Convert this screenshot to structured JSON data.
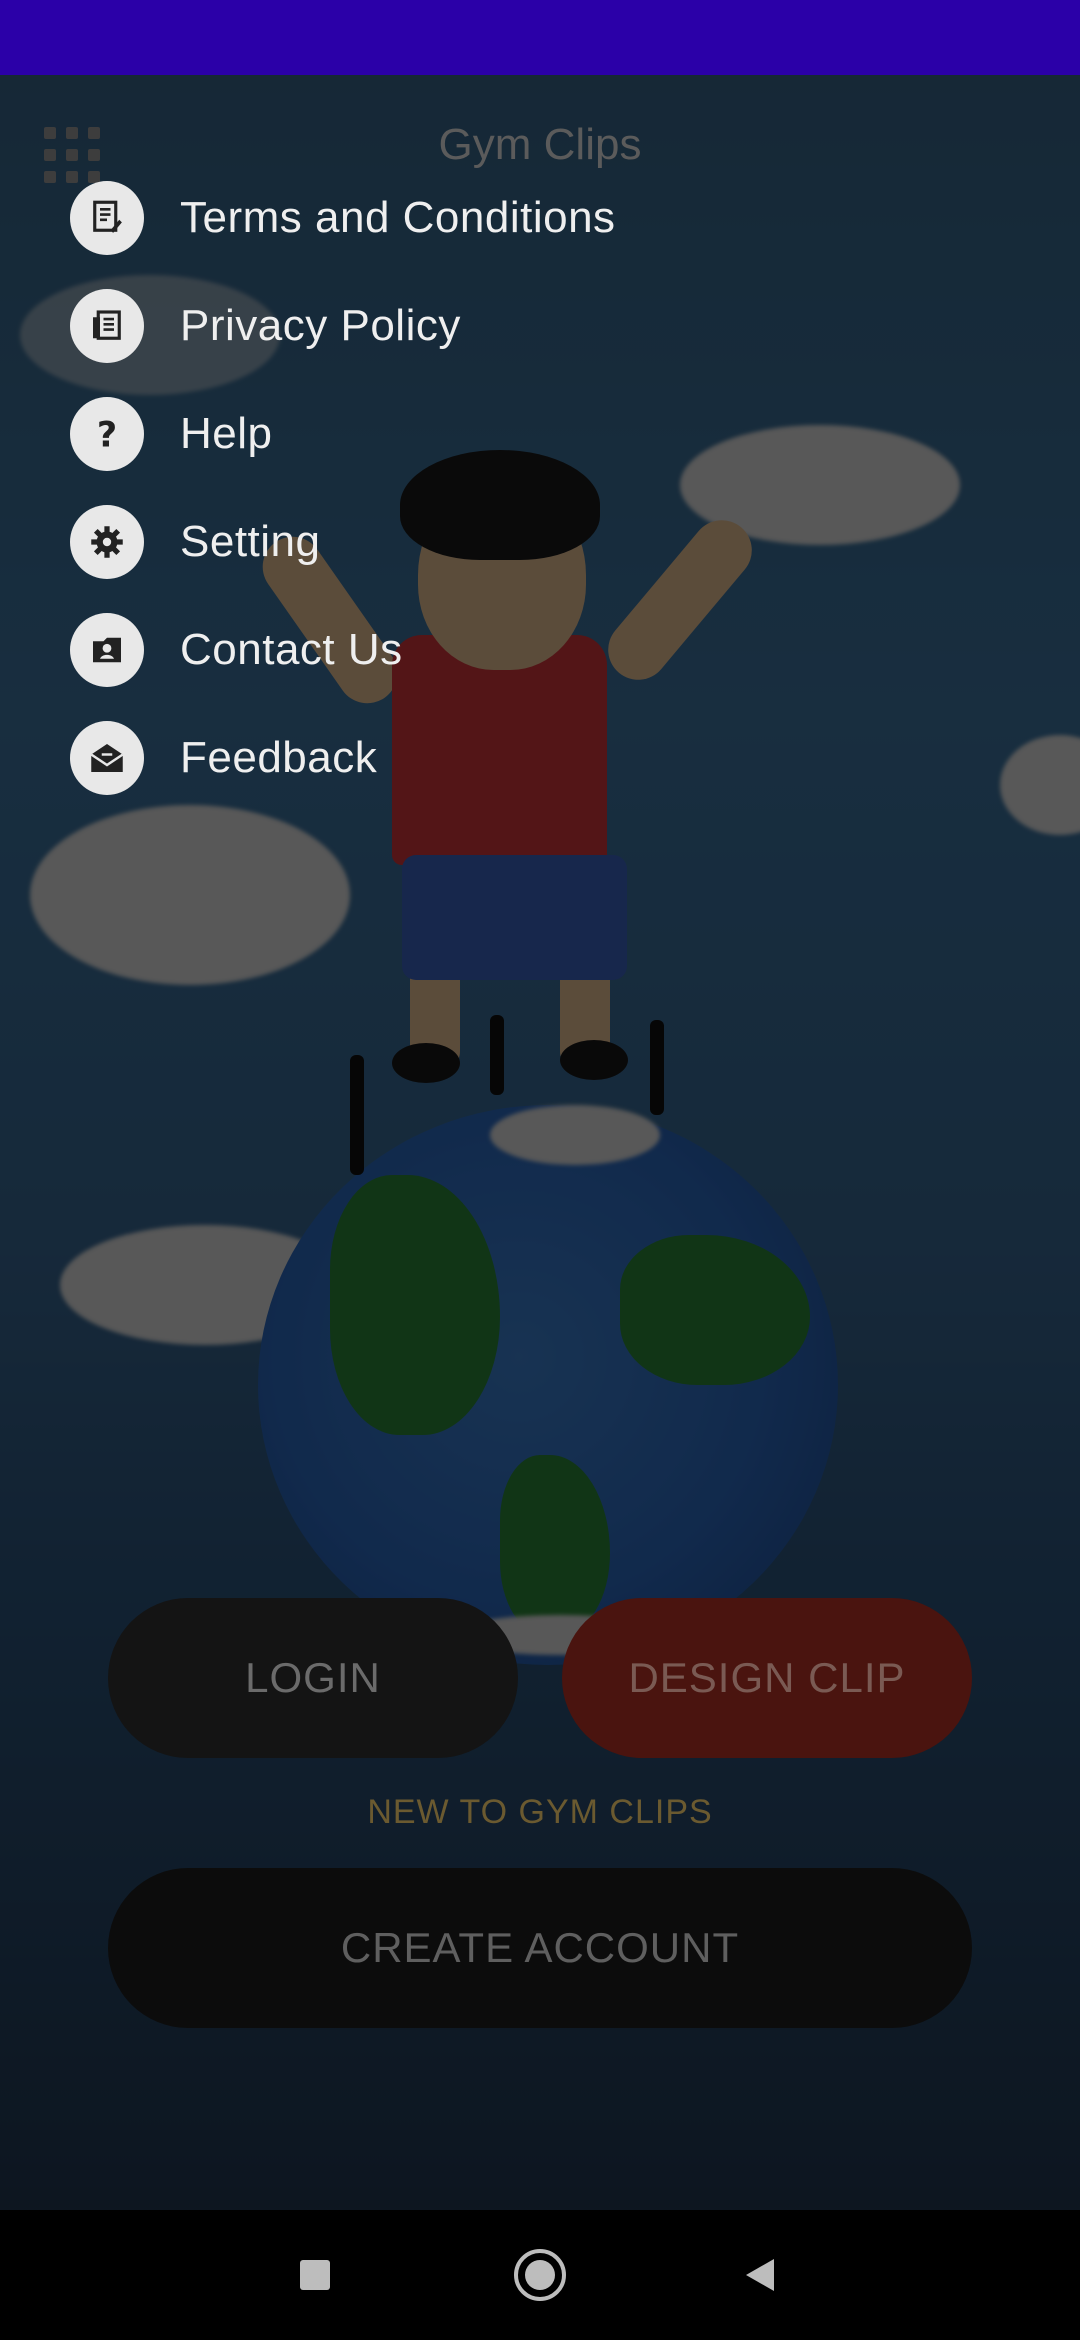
{
  "app": {
    "title": "Gym Clips"
  },
  "drawer": {
    "items": [
      {
        "label": "Terms and Conditions",
        "icon": "terms-icon"
      },
      {
        "label": "Privacy Policy",
        "icon": "privacy-icon"
      },
      {
        "label": "Help",
        "icon": "help-icon"
      },
      {
        "label": "Setting",
        "icon": "gear-icon"
      },
      {
        "label": "Contact Us",
        "icon": "contact-icon"
      },
      {
        "label": "Feedback",
        "icon": "feedback-icon"
      }
    ]
  },
  "buttons": {
    "login": "LOGIN",
    "design_clip": "DESIGN CLIP",
    "new_to": "NEW TO GYM CLIPS",
    "create_account": "CREATE ACCOUNT"
  },
  "colors": {
    "status_bar": "#2b00a8",
    "drawer_text": "#efefef",
    "design_button": "#4a140f"
  },
  "nav": {
    "icons": [
      "recents-square-icon",
      "home-circle-icon",
      "back-triangle-icon"
    ]
  }
}
